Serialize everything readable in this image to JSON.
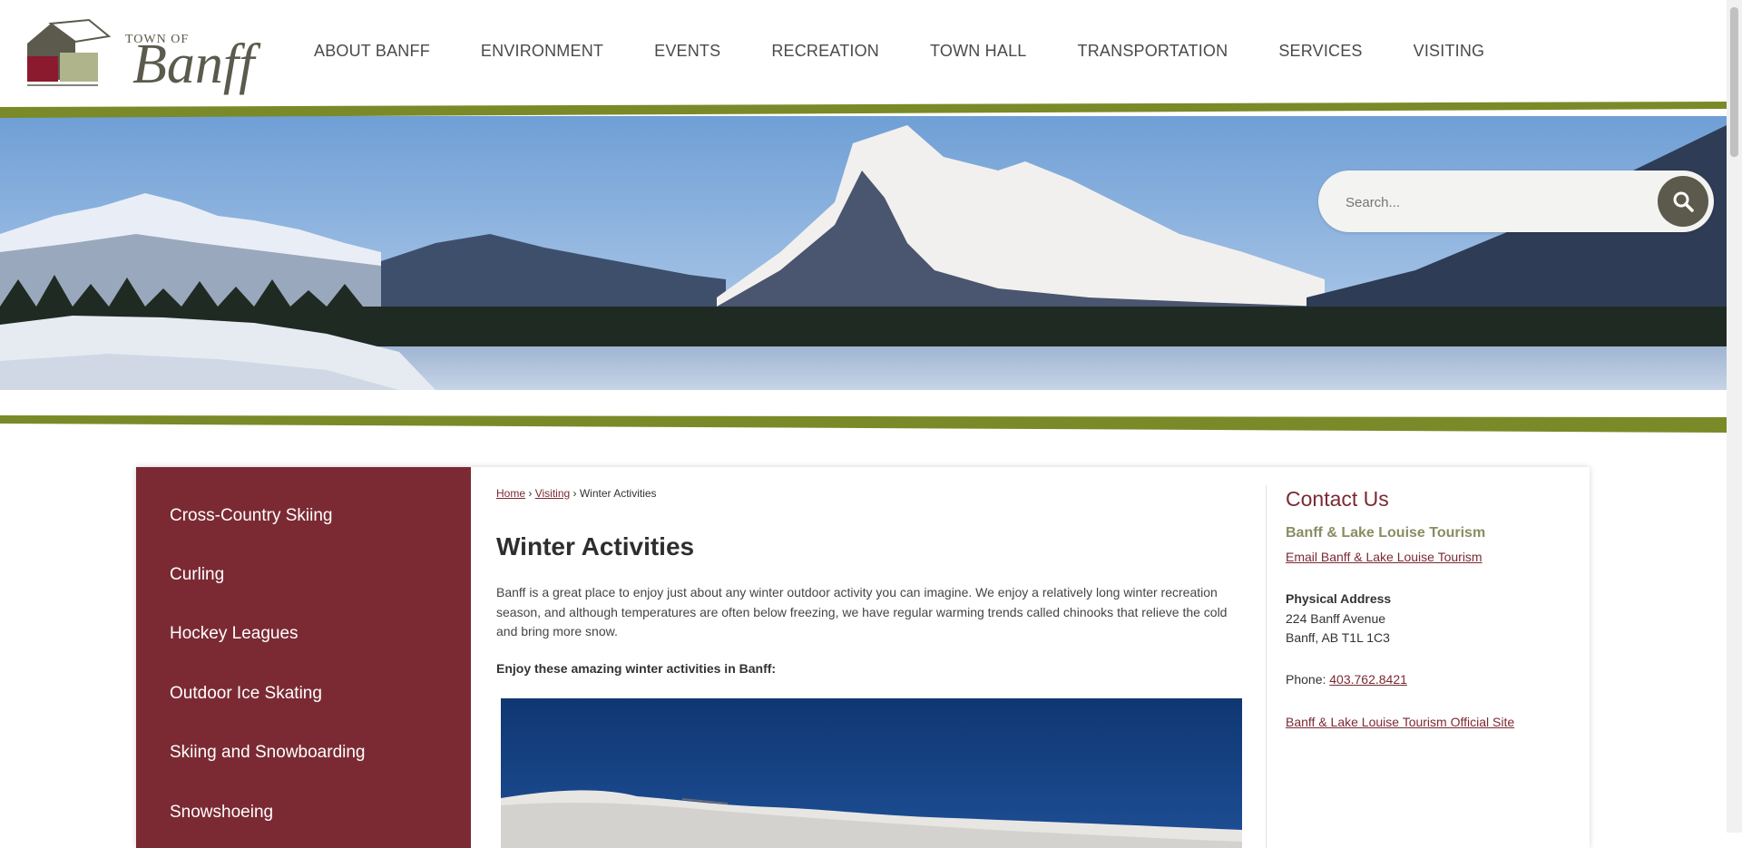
{
  "logo": {
    "small_text": "TOWN OF",
    "big_text": "Banff"
  },
  "nav": {
    "items": [
      "ABOUT BANFF",
      "ENVIRONMENT",
      "EVENTS",
      "RECREATION",
      "TOWN HALL",
      "TRANSPORTATION",
      "SERVICES",
      "VISITING"
    ]
  },
  "search": {
    "placeholder": "Search..."
  },
  "sidebar": {
    "items": [
      {
        "label": "Cross-Country Skiing"
      },
      {
        "label": "Curling"
      },
      {
        "label": "Hockey Leagues"
      },
      {
        "label": "Outdoor Ice Skating"
      },
      {
        "label": "Skiing and Snowboarding"
      },
      {
        "label": "Snowshoeing"
      }
    ]
  },
  "breadcrumb": {
    "home": "Home",
    "visiting": "Visiting",
    "current": "Winter Activities",
    "separator": "›"
  },
  "main": {
    "title": "Winter Activities",
    "intro": "Banff is a great place to enjoy just about any winter outdoor activity you can imagine. We enjoy a relatively long winter recreation season, and although temperatures are often below freezing, we have regular warming trends called chinooks that relieve the cold and bring more snow.",
    "subhead": "Enjoy these amazing winter activities in Banff:"
  },
  "contact": {
    "title": "Contact Us",
    "org": "Banff & Lake Louise Tourism",
    "email_link": "Email Banff & Lake Louise Tourism",
    "address_label": "Physical Address",
    "address_line1": "224 Banff Avenue",
    "address_line2": "Banff, AB T1L 1C3",
    "phone_label": "Phone: ",
    "phone": "403.762.8421",
    "official_site": "Banff & Lake Louise Tourism Official Site"
  },
  "colors": {
    "brand_maroon": "#7b2a33",
    "brand_green": "#7a8a28",
    "brand_olive": "#8a8d62",
    "search_button": "#5c5a4c"
  }
}
